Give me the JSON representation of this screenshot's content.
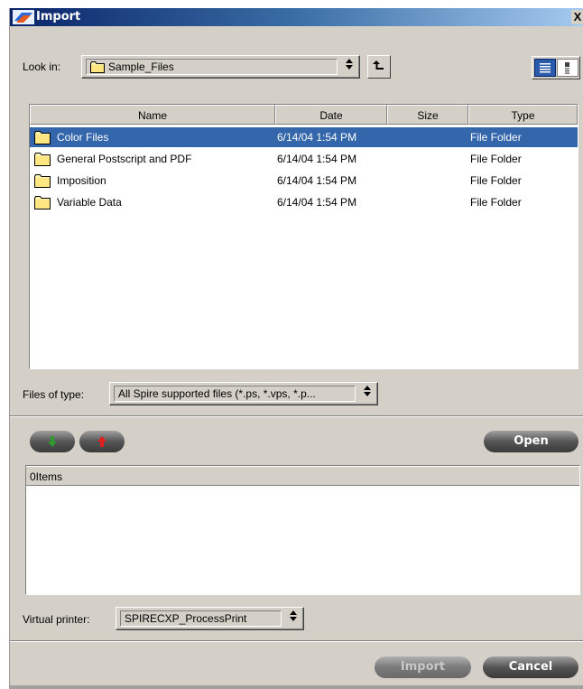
{
  "window": {
    "title": "Import",
    "close_glyph": "X"
  },
  "look_in": {
    "label": "Look in:",
    "value": "Sample_Files",
    "arrow": "↕",
    "up_icon": "↑"
  },
  "file_list": {
    "columns": [
      "Name",
      "Date",
      "Size",
      "Type"
    ],
    "rows": [
      {
        "name": "Color Files",
        "date": "6/14/04 1:54 PM",
        "size": "",
        "type": "File Folder",
        "selected": true
      },
      {
        "name": "General Postscript and PDF",
        "date": "6/14/04 1:54 PM",
        "size": "",
        "type": "File Folder",
        "selected": false
      },
      {
        "name": "Imposition",
        "date": "6/14/04 1:54 PM",
        "size": "",
        "type": "File Folder",
        "selected": false
      },
      {
        "name": "Variable Data",
        "date": "6/14/04 1:54 PM",
        "size": "",
        "type": "File Folder",
        "selected": false
      }
    ]
  },
  "files_of_type": {
    "label": "Files of type:",
    "value": "All Spire supported files (*.ps, *.vps, *.p..."
  },
  "buttons": {
    "open": "Open",
    "import": "Import",
    "cancel": "Cancel"
  },
  "items": {
    "header": "0Items"
  },
  "virtual_printer": {
    "label": "Virtual printer:",
    "value": "SPIRECXP_ProcessPrint"
  },
  "colors": {
    "selection": "#3366aa",
    "down_arrow": "#2e9a2e",
    "up_arrow": "#e02020",
    "titlebar": "#0a246a"
  }
}
